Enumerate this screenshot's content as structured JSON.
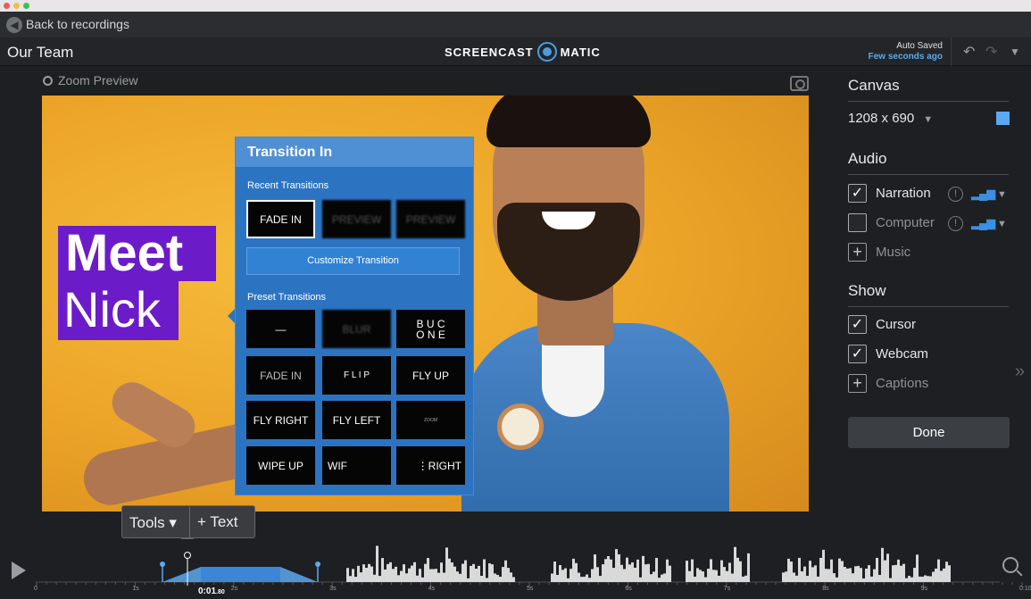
{
  "nav": {
    "back_label": "Back to recordings"
  },
  "header": {
    "project_title": "Our Team",
    "brand_left": "SCREENCAST",
    "brand_right": "MATIC",
    "autosave_label": "Auto Saved",
    "autosave_time": "Few seconds ago"
  },
  "preview": {
    "zoom_label": "Zoom Preview",
    "overlay_line1": "Meet",
    "overlay_line2": "Nick"
  },
  "transition_panel": {
    "title": "Transition In",
    "recent_label": "Recent Transitions",
    "recent": [
      "FADE IN",
      "PREVIEW",
      "PREVIEW"
    ],
    "customize_label": "Customize Transition",
    "preset_label": "Preset Transitions",
    "presets": [
      "—",
      "BLUR",
      "B U C\nO N E",
      "FADE IN",
      "F L I P",
      "FLY UP",
      "FLY RIGHT",
      "FLY LEFT",
      "ZOOM",
      "WIPE UP",
      "WIF",
      "⋮RIGHT"
    ]
  },
  "sidebar": {
    "canvas_heading": "Canvas",
    "canvas_size": "1208 x 690",
    "audio_heading": "Audio",
    "narration_label": "Narration",
    "computer_label": "Computer",
    "music_label": "Music",
    "show_heading": "Show",
    "cursor_label": "Cursor",
    "webcam_label": "Webcam",
    "captions_label": "Captions",
    "done_label": "Done",
    "accent_color": "#5ba9f0"
  },
  "tools_popover": {
    "tools_label": "Tools ▾",
    "text_label": "+ Text"
  },
  "timeline": {
    "tick_labels": [
      "0",
      "1s",
      "2s",
      "3s",
      "4s",
      "5s",
      "6s",
      "7s",
      "8s",
      "9s",
      "0:10"
    ],
    "current_time_main": "0:01",
    "current_time_frac": ".80"
  }
}
